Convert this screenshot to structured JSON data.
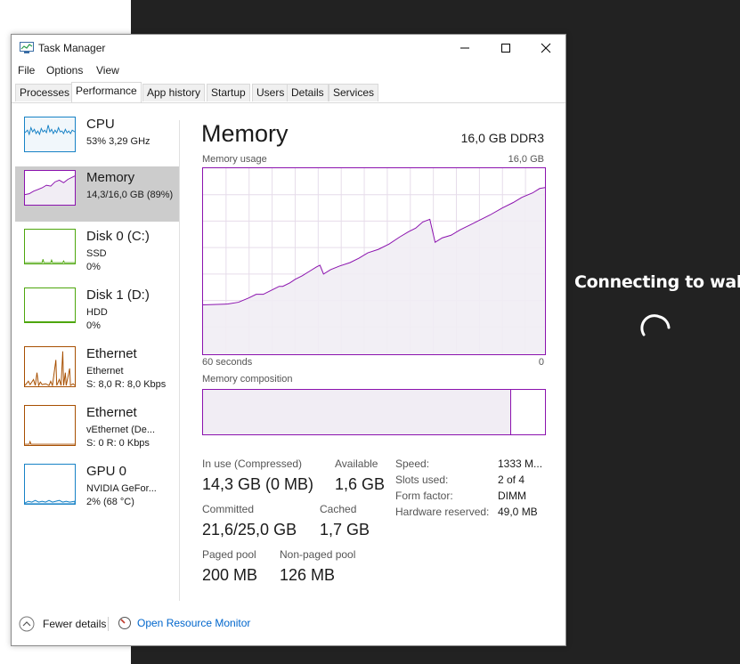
{
  "overlay": {
    "connecting_text": "Connecting to wallet"
  },
  "window": {
    "title": "Task Manager",
    "menu": [
      "File",
      "Options",
      "View"
    ],
    "tabs": [
      "Processes",
      "Performance",
      "App history",
      "Startup",
      "Users",
      "Details",
      "Services"
    ],
    "active_tab": "Performance"
  },
  "sidebar": {
    "items": [
      {
        "title": "CPU",
        "lines": [
          "53%  3,29 GHz"
        ],
        "color": "#1782c6",
        "usage": 0.53
      },
      {
        "title": "Memory",
        "lines": [
          "14,3/16,0 GB (89%)"
        ],
        "color": "#8b12ae",
        "usage": 0.89
      },
      {
        "title": "Disk 0 (C:)",
        "lines": [
          "SSD",
          "0%"
        ],
        "color": "#4da60c",
        "usage": 0.0
      },
      {
        "title": "Disk 1 (D:)",
        "lines": [
          "HDD",
          "0%"
        ],
        "color": "#4da60c",
        "usage": 0.0
      },
      {
        "title": "Ethernet",
        "lines": [
          "Ethernet",
          "S: 8,0  R: 8,0 Kbps"
        ],
        "color": "#a74f01"
      },
      {
        "title": "Ethernet",
        "lines": [
          "vEthernet (De...",
          "S: 0  R: 0 Kbps"
        ],
        "color": "#a74f01"
      },
      {
        "title": "GPU 0",
        "lines": [
          "NVIDIA GeFor...",
          "2%  (68 °C)"
        ],
        "color": "#1782c6",
        "usage": 0.02
      }
    ]
  },
  "memory": {
    "title": "Memory",
    "type": "16,0 GB DDR3",
    "usage_label": "Memory usage",
    "usage_max": "16,0 GB",
    "time_left": "60 seconds",
    "time_right": "0",
    "composition_label": "Memory composition",
    "composition_in_use": 0.9,
    "accent": "#8b12ae",
    "fill": "#f1edf4",
    "stats": {
      "in_use_label": "In use (Compressed)",
      "in_use_value": "14,3 GB (0 MB)",
      "available_label": "Available",
      "available_value": "1,6 GB",
      "committed_label": "Committed",
      "committed_value": "21,6/25,0 GB",
      "cached_label": "Cached",
      "cached_value": "1,7 GB",
      "paged_label": "Paged pool",
      "paged_value": "200 MB",
      "nonpaged_label": "Non-paged pool",
      "nonpaged_value": "126 MB"
    },
    "details": {
      "speed_label": "Speed:",
      "speed_value": "1333 M...",
      "slots_label": "Slots used:",
      "slots_value": "2 of 4",
      "form_label": "Form factor:",
      "form_value": "DIMM",
      "hw_label": "Hardware reserved:",
      "hw_value": "49,0 MB"
    }
  },
  "footer": {
    "fewer_details": "Fewer details",
    "open_resmon": "Open Resource Monitor"
  },
  "icons": [
    "app-icon",
    "minimize-icon",
    "maximize-icon",
    "close-icon",
    "chevron-up-icon",
    "resource-monitor-icon",
    "spinner-icon"
  ]
}
